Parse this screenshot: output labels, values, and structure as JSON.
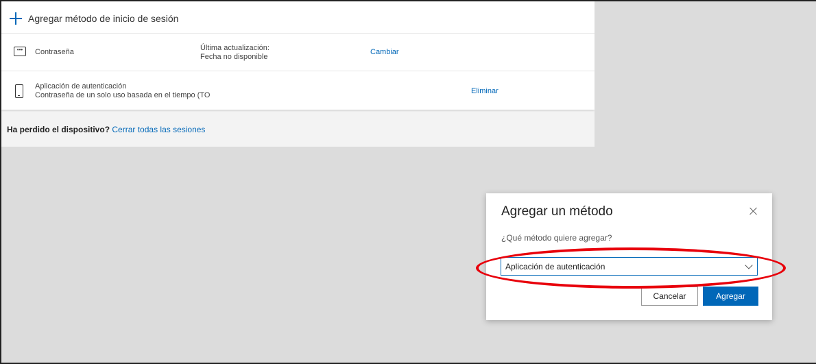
{
  "background": {
    "add_method_label": "Agregar método de inicio de sesión",
    "methods": [
      {
        "icon": "password-icon",
        "name": "Contraseña",
        "meta_label": "Última actualización:",
        "meta_value": "Fecha no disponible",
        "action": "Cambiar"
      },
      {
        "icon": "phone-icon",
        "name": "Aplicación de autenticación",
        "description": "Contraseña de un solo uso basada en el tiempo (TO",
        "action": "Eliminar"
      }
    ],
    "lost_device_question": "Ha perdido el dispositivo?",
    "sign_out_link": "Cerrar todas las sesiones"
  },
  "dialog": {
    "title": "Agregar un método",
    "question": "¿Qué método quiere agregar?",
    "selected_method": "Aplicación de autenticación",
    "cancel_label": "Cancelar",
    "add_label": "Agregar"
  },
  "colors": {
    "accent": "#0067b8",
    "highlight": "#e8000b"
  }
}
